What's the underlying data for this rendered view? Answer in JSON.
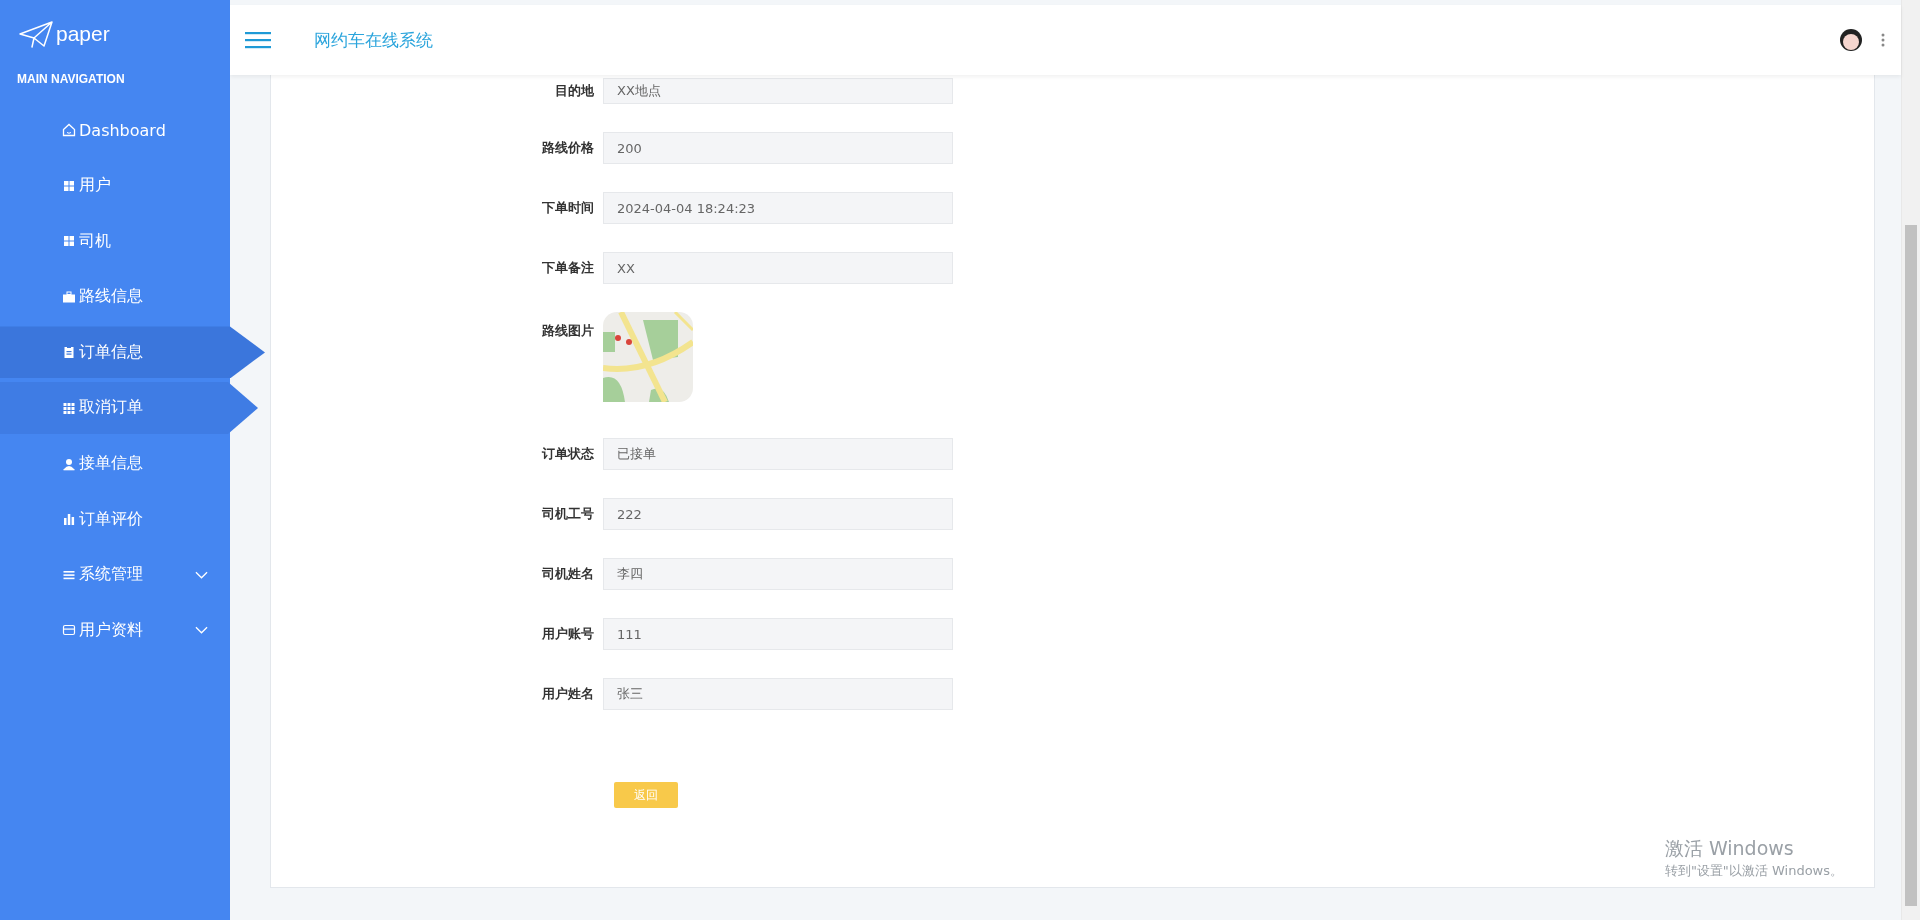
{
  "sidebar": {
    "logo": "paper",
    "section_title": "MAIN NAVIGATION",
    "items": [
      {
        "label": "Dashboard",
        "selected": false,
        "hovered": false
      },
      {
        "label": "用户",
        "selected": false,
        "hovered": false
      },
      {
        "label": "司机",
        "selected": false,
        "hovered": false
      },
      {
        "label": "路线信息",
        "selected": false,
        "hovered": false
      },
      {
        "label": "订单信息",
        "selected": true,
        "hovered": false
      },
      {
        "label": "取消订单",
        "selected": false,
        "hovered": true
      },
      {
        "label": "接单信息",
        "selected": false,
        "hovered": false
      },
      {
        "label": "订单评价",
        "selected": false,
        "hovered": false
      },
      {
        "label": "系统管理",
        "selected": false,
        "hovered": false,
        "expanded": false
      },
      {
        "label": "用户资料",
        "selected": false,
        "hovered": false,
        "expanded": false
      }
    ]
  },
  "header": {
    "title": "网约车在线系统"
  },
  "form": {
    "fields": [
      {
        "kind": "text",
        "label": "目的地",
        "value": "XX地点"
      },
      {
        "kind": "text",
        "label": "路线价格",
        "value": "200"
      },
      {
        "kind": "text",
        "label": "下单时间",
        "value": "2024-04-04 18:24:23"
      },
      {
        "kind": "text",
        "label": "下单备注",
        "value": "XX"
      },
      {
        "kind": "picture",
        "label": "路线图片"
      },
      {
        "kind": "text",
        "label": "订单状态",
        "value": "已接单"
      },
      {
        "kind": "text",
        "label": "司机工号",
        "value": "222"
      },
      {
        "kind": "text",
        "label": "司机姓名",
        "value": "李四"
      },
      {
        "kind": "text",
        "label": "用户账号",
        "value": "111"
      },
      {
        "kind": "text",
        "label": "用户姓名",
        "value": "张三"
      }
    ],
    "back_button": "返回"
  },
  "windows_activation": {
    "title": "激活 Windows",
    "subtitle": "转到\"设置\"以激活 Windows。"
  }
}
